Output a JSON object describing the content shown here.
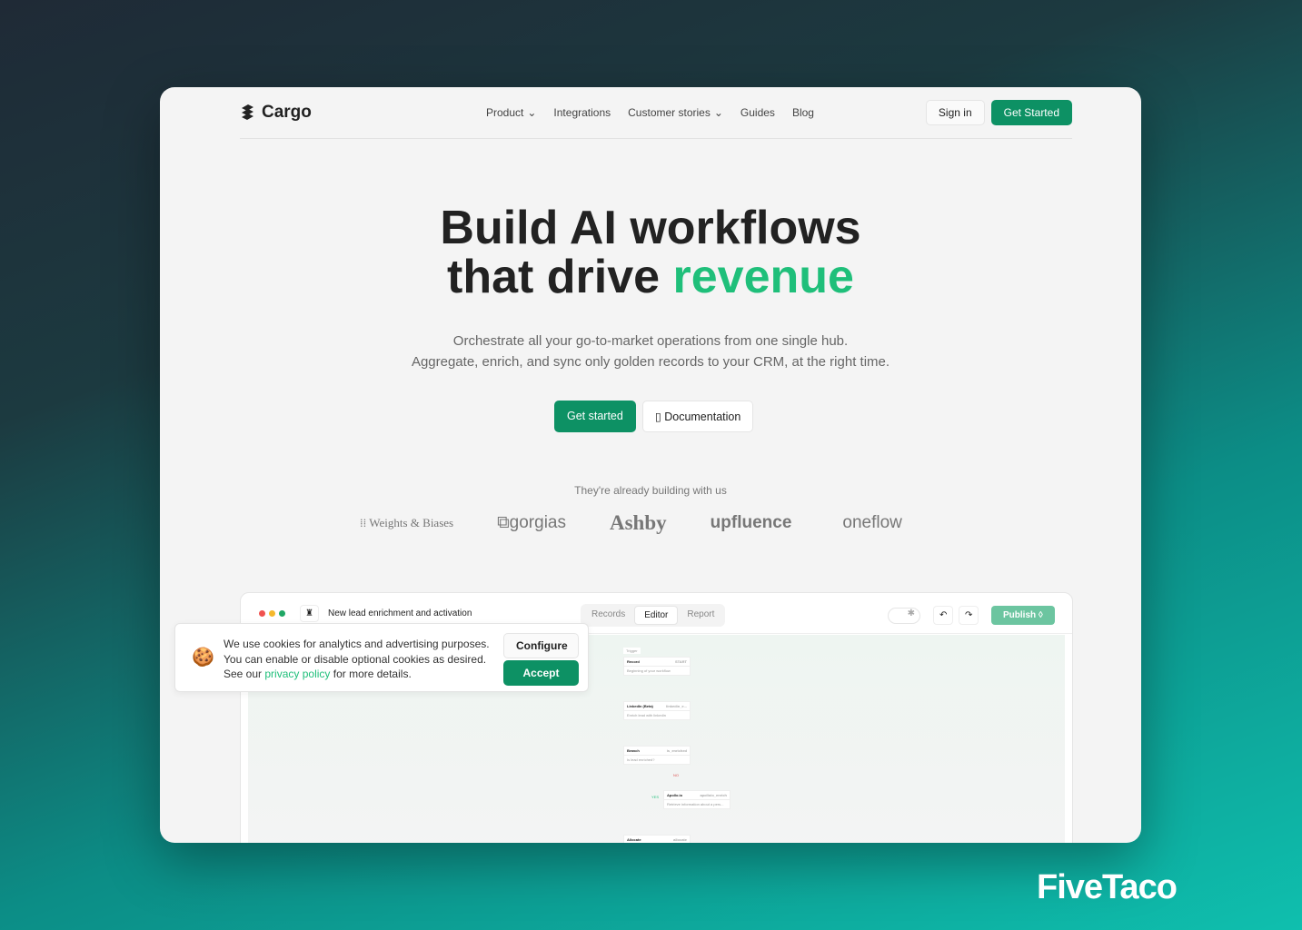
{
  "nav": {
    "brand": "Cargo",
    "links": [
      "Product",
      "Integrations",
      "Customer stories",
      "Guides",
      "Blog"
    ],
    "sign_in": "Sign in",
    "get_started": "Get Started"
  },
  "hero": {
    "title_line1": "Build AI workflows",
    "title_line2_a": "that drive ",
    "title_line2_b": "revenue",
    "sub1": "Orchestrate all your go-to-market operations from one single hub.",
    "sub2": "Aggregate, enrich, and sync only golden records to your CRM, at the right time.",
    "primary": "Get started",
    "secondary": "Documentation"
  },
  "social": {
    "tagline": "They're already building with us",
    "logos": [
      "Weights & Biases",
      "gorgias",
      "Ashby",
      "upfluence",
      "oneflow"
    ]
  },
  "app": {
    "workflow_name": "New lead enrichment and activation",
    "tabs": [
      "Records",
      "Editor",
      "Report"
    ],
    "active_tab": "Editor",
    "publish": "Publish",
    "nodes": [
      {
        "title": "Record",
        "tag": "START",
        "desc": "Beginning of your workflow"
      },
      {
        "title": "LinkedIn (Beta)",
        "tag": "linkedin_e...",
        "desc": "Enrich lead with linkedin"
      },
      {
        "title": "Branch",
        "tag": "is_enriched",
        "desc": "Is lead enriched?"
      },
      {
        "title": "Apollo.io",
        "tag": "apolloio_enrich",
        "desc": "Retrieve information about a pers..."
      },
      {
        "title": "Allocate",
        "tag": "allocate",
        "desc": ""
      }
    ],
    "trigger": "Trigger",
    "no": "NO",
    "yes": "YES"
  },
  "cookie": {
    "line1": "We use cookies for analytics and advertising purposes.",
    "line2": "You can enable or disable optional cookies as desired.",
    "line3_a": "See our ",
    "link": "privacy policy",
    "line3_b": " for more details.",
    "configure": "Configure",
    "accept": "Accept"
  },
  "watermark": "FiveTaco",
  "colors": {
    "accent": "#1fbf7a",
    "button": "#0d9164"
  }
}
